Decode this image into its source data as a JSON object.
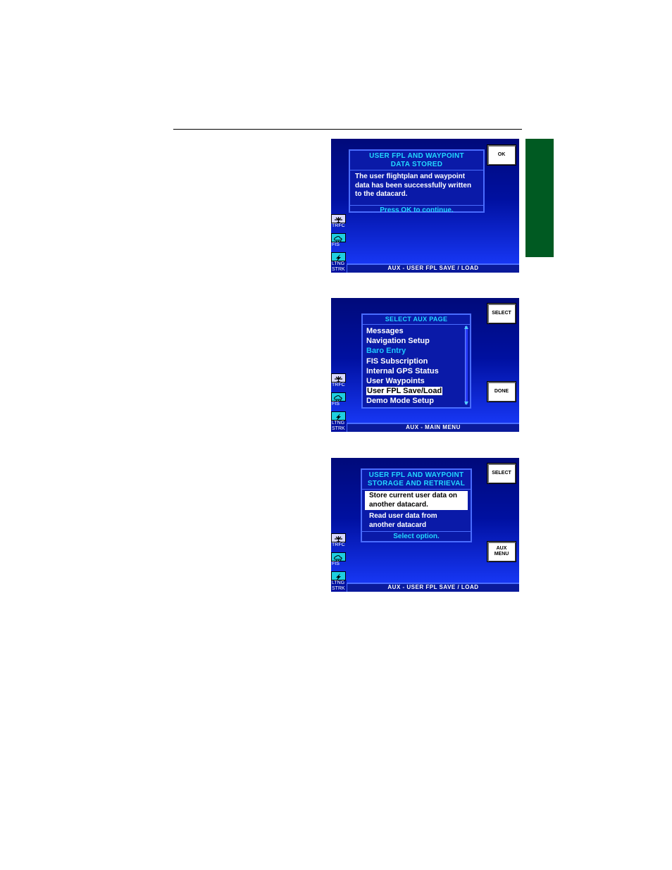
{
  "screens": [
    {
      "title": "USER FPL AND WAYPOINT\nDATA STORED",
      "body": "The user flightplan and waypoint data has been successfully written to the datacard.",
      "footer": "Press OK to continue.",
      "softkeys": [
        "OK"
      ],
      "status": "AUX - USER FPL SAVE / LOAD"
    },
    {
      "title": "SELECT AUX PAGE",
      "items": [
        "Messages",
        "Navigation Setup",
        "Baro Entry",
        "FIS Subscription",
        "Internal GPS Status",
        "User Waypoints",
        "User FPL Save/Load",
        "Demo Mode Setup"
      ],
      "selected_index": 6,
      "dim_index": 2,
      "softkeys": [
        "SELECT",
        "DONE"
      ],
      "status": "AUX - MAIN MENU"
    },
    {
      "title": "USER FPL AND WAYPOINT\nSTORAGE AND RETRIEVAL",
      "options": [
        "Store current user data on another datacard.",
        "Read user data from another datacard"
      ],
      "footer": "Select option.",
      "softkeys": [
        "SELECT",
        "AUX\nMENU"
      ],
      "status": "AUX - USER FPL SAVE / LOAD"
    }
  ],
  "sidebar": {
    "items": [
      "TRFC",
      "FIS",
      "LTNG\nSTRK"
    ]
  },
  "icons": [
    "traffic-icon",
    "weather-icon",
    "lightning-icon"
  ],
  "colors": {
    "tab_green": "#005a22",
    "title_cyan": "#22d8ff",
    "screen_blue": "#0010a0"
  }
}
